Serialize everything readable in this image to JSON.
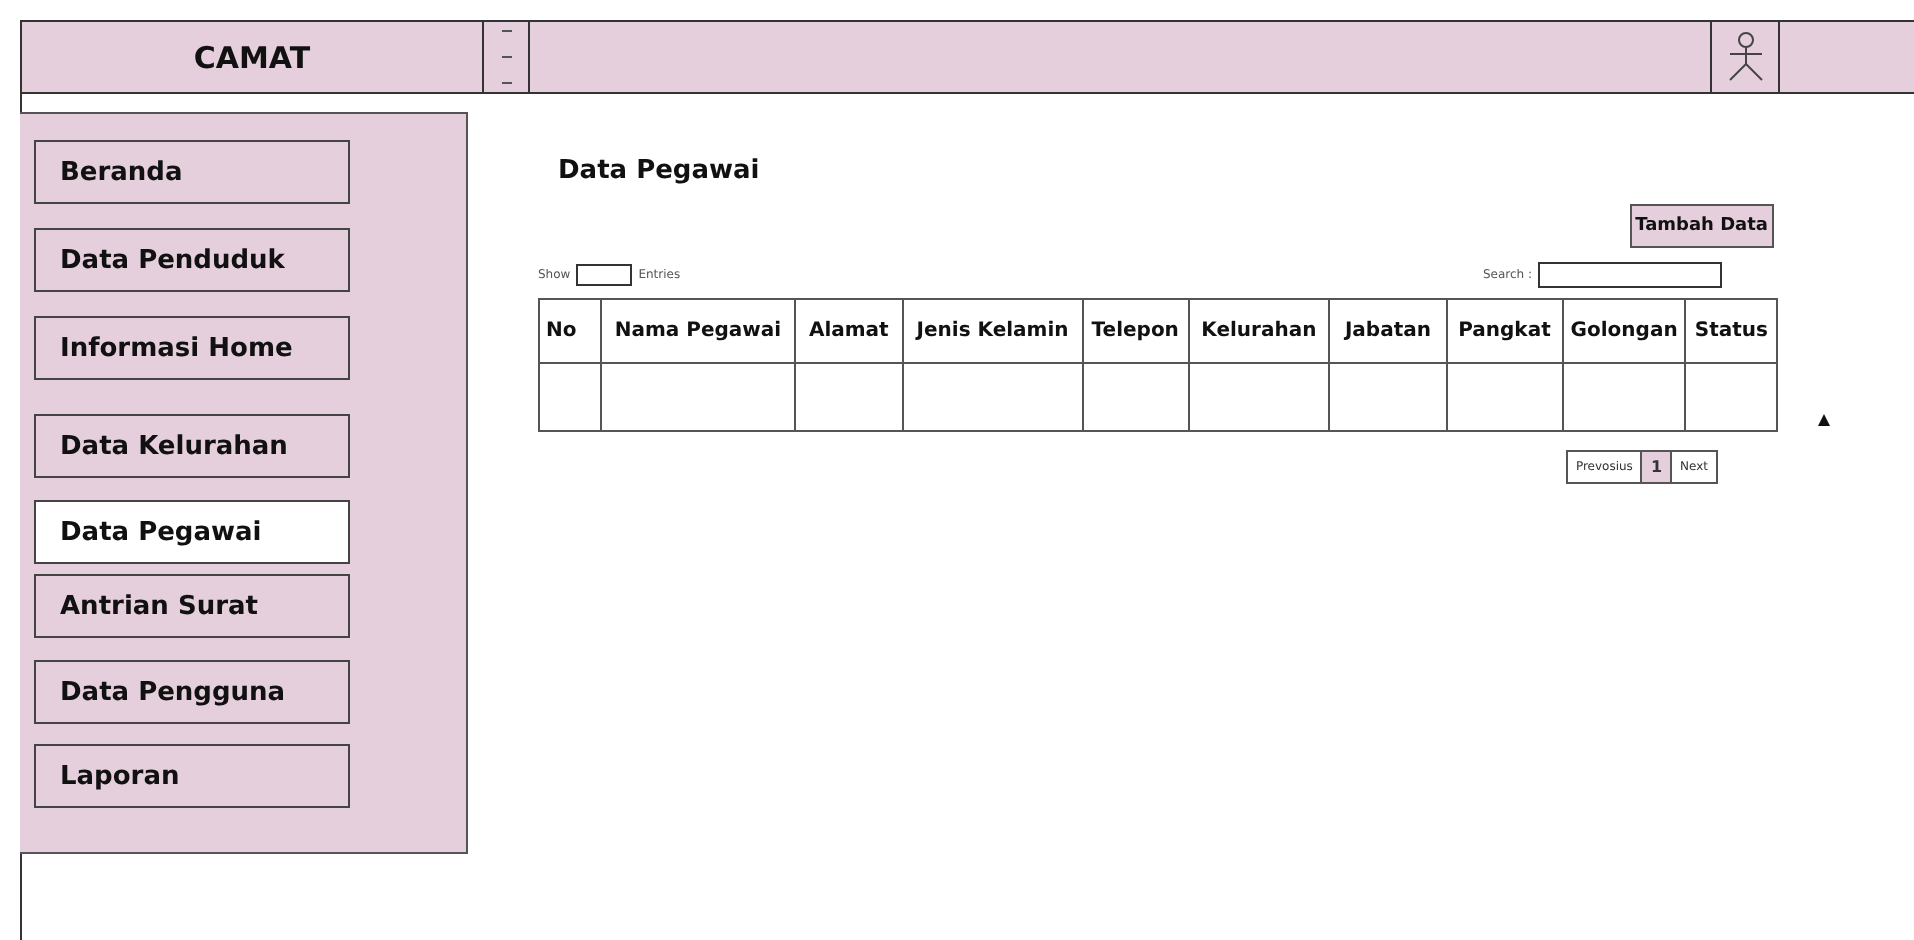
{
  "header": {
    "title": "CAMAT"
  },
  "sidebar": {
    "items": [
      {
        "label": "Beranda",
        "selected": false
      },
      {
        "label": "Data Penduduk",
        "selected": false
      },
      {
        "label": "Informasi Home",
        "selected": false
      },
      {
        "label": "Data Kelurahan",
        "selected": false
      },
      {
        "label": "Data Pegawai",
        "selected": true
      },
      {
        "label": "Antrian Surat",
        "selected": false
      },
      {
        "label": "Data Pengguna",
        "selected": false
      },
      {
        "label": "Laporan",
        "selected": false
      }
    ]
  },
  "content": {
    "title": "Data Pegawai",
    "add_button": "Tambah Data",
    "show_label": "Show",
    "entries_label": "Entries",
    "search_label": "Search :",
    "table": {
      "columns": [
        "No",
        "Nama Pegawai",
        "Alamat",
        "Jenis Kelamin",
        "Telepon",
        "Kelurahan",
        "Jabatan",
        "Pangkat",
        "Golongan",
        "Status"
      ]
    },
    "pagination": {
      "previous": "Prevosius",
      "pages": [
        {
          "label": "1",
          "selected": true
        }
      ],
      "next": "Next"
    }
  }
}
